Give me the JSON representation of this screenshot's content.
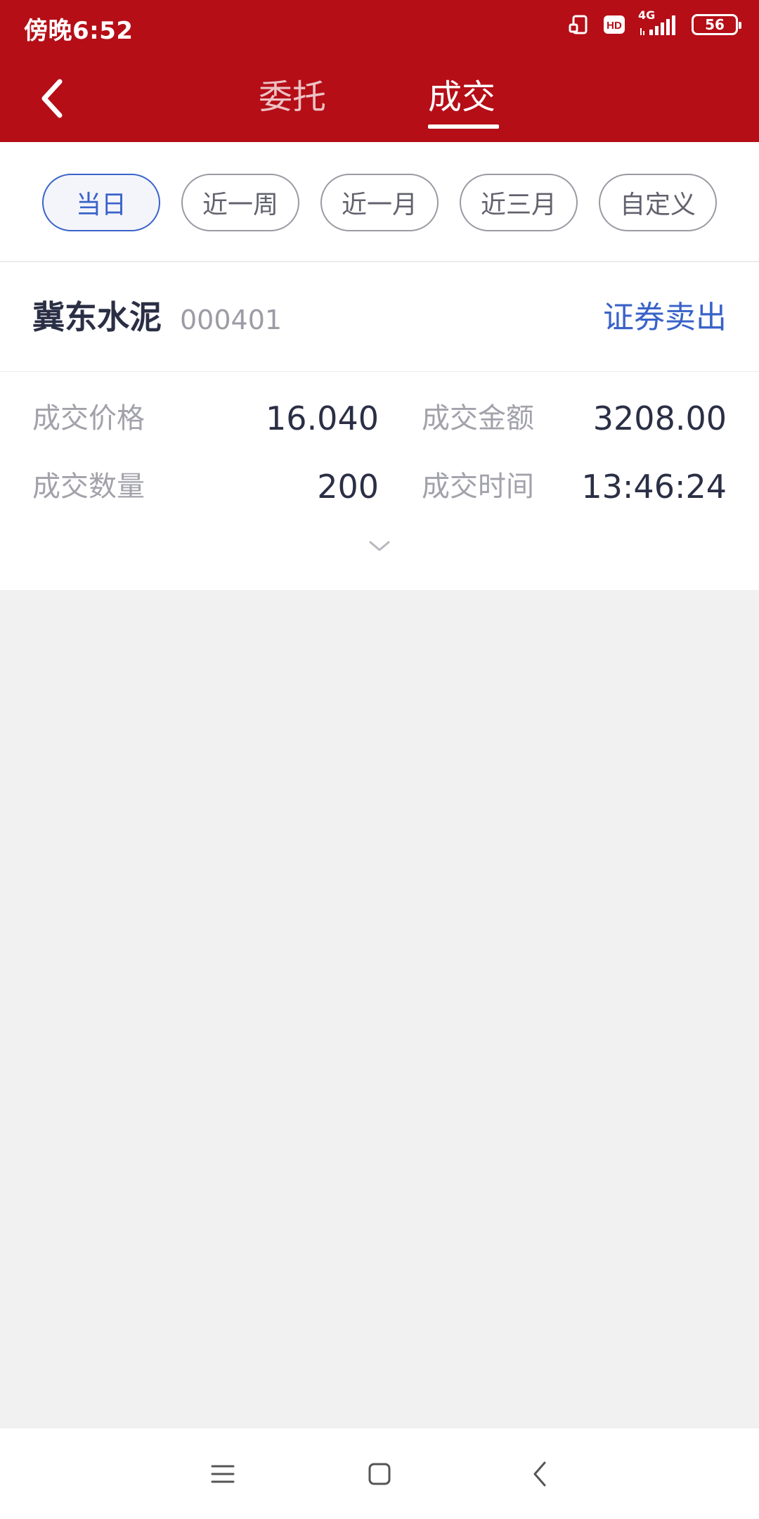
{
  "status_bar": {
    "time": "傍晚6:52",
    "network": "4G",
    "hd": "HD",
    "battery": "56"
  },
  "nav": {
    "tabs": [
      {
        "label": "委托",
        "active": false
      },
      {
        "label": "成交",
        "active": true
      }
    ]
  },
  "filters": [
    {
      "label": "当日",
      "active": true
    },
    {
      "label": "近一周",
      "active": false
    },
    {
      "label": "近一月",
      "active": false
    },
    {
      "label": "近三月",
      "active": false
    },
    {
      "label": "自定义",
      "active": false
    }
  ],
  "record": {
    "stock_name": "冀东水泥",
    "stock_code": "000401",
    "action": "证券卖出",
    "fields": [
      {
        "label": "成交价格",
        "value": "16.040"
      },
      {
        "label": "成交金额",
        "value": "3208.00"
      },
      {
        "label": "成交数量",
        "value": "200"
      },
      {
        "label": "成交时间",
        "value": "13:46:24"
      }
    ]
  },
  "colors": {
    "header": "#b50e17",
    "accent": "#3a63c9",
    "text_primary": "#2b2f45",
    "text_secondary": "#a2a2ab",
    "background": "#f1f1f2"
  }
}
